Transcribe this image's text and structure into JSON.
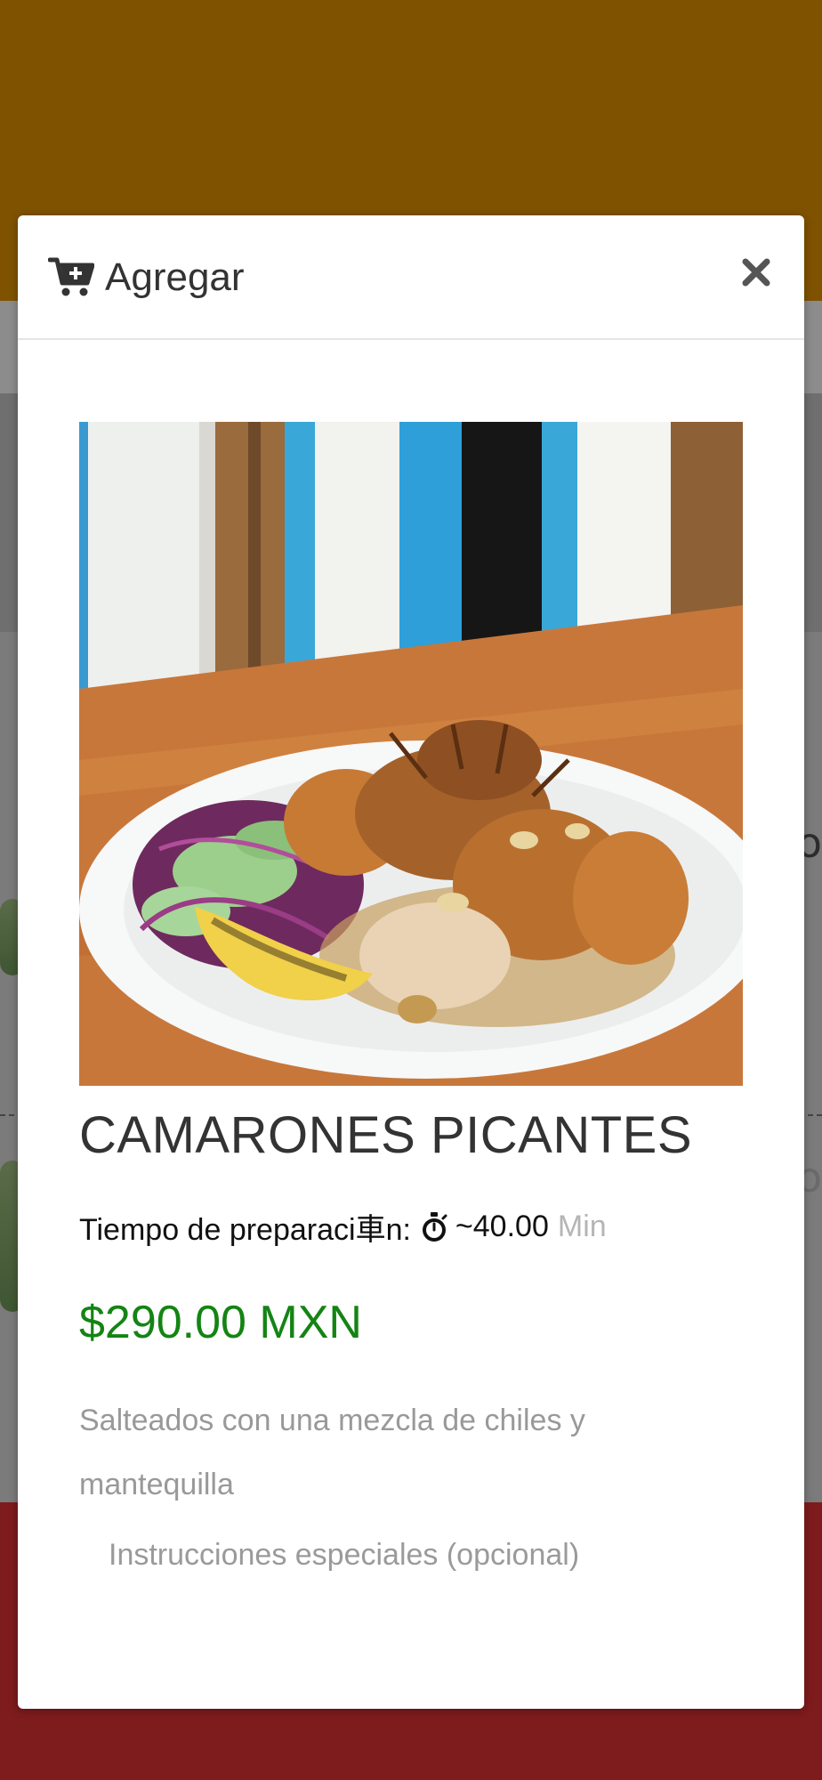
{
  "colors": {
    "header_bg": "#7f5200",
    "footer_bg": "#7e1b1d",
    "price_color": "#148414",
    "muted_text": "#999999"
  },
  "modal": {
    "title": "Agregar",
    "title_icon": "cart-plus-icon",
    "close_icon": "close-icon"
  },
  "dish": {
    "name": "CAMARONES PICANTES",
    "prep_label": "Tiempo de preparaci車n:",
    "prep_icon": "stopwatch-icon",
    "prep_value": "~40.00",
    "prep_unit": "Min",
    "price": "$290.00 MXN",
    "description": "Salteados con una mezcla de chiles y mantequilla"
  },
  "instructions": {
    "placeholder": "Instrucciones especiales (opcional)"
  },
  "background": {
    "peek_text_1": "o",
    "peek_text_2": "o"
  }
}
